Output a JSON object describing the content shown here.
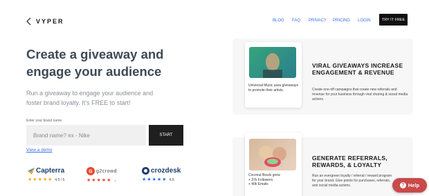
{
  "header": {
    "logo_text": "VYPER",
    "nav": [
      {
        "label": "BLOG"
      },
      {
        "label": "FAQ"
      },
      {
        "label": "PRIVACY"
      },
      {
        "label": "PRICING"
      },
      {
        "label": "LOGIN"
      }
    ],
    "cta_label": "TRY IT FREE"
  },
  "hero": {
    "headline": "Create a giveaway and engage your audience",
    "subhead": "Run a giveaway to engage your audience and foster brand loyalty. It's FREE to start!",
    "field_label": "Enter your brand name",
    "field_placeholder": "Brand name? ex - Nike",
    "field_value": "",
    "start_label": "START",
    "demo_link": "View a demo"
  },
  "reviews": [
    {
      "name": "Capterra",
      "rating": "4.5 / 5",
      "star_color": "#f5a623"
    },
    {
      "name": "g2crowd",
      "rating": "",
      "star_color": "#e8452c"
    },
    {
      "name": "crozdesk",
      "rating": "4.9",
      "star_color": "#2f6fd8"
    }
  ],
  "cards": [
    {
      "caption": "Universal Music uses giveaways to promote their artists.",
      "title": "VIRAL GIVEAWAYS INCREASE ENGAGEMENT & REVENUE",
      "description": "Create one-off campaigns that create new referrals and revenue for your business through viral sharing & social media actions."
    },
    {
      "caption_lines": [
        "Coconut Bowls grew",
        "+ 37k Followers",
        "+ 40k Emails"
      ],
      "title": "GENERATE REFERRALS, REWARDS, & LOYALTY",
      "description": "Run an evergreen loyalty / referral / reward program for your brand. Give points for purchases, referrals, and social media actions."
    }
  ],
  "help": {
    "label": "Help",
    "icon": "question-icon"
  },
  "colors": {
    "link": "#3c6ee0",
    "help": "#c94a4a",
    "dark": "#111111"
  }
}
